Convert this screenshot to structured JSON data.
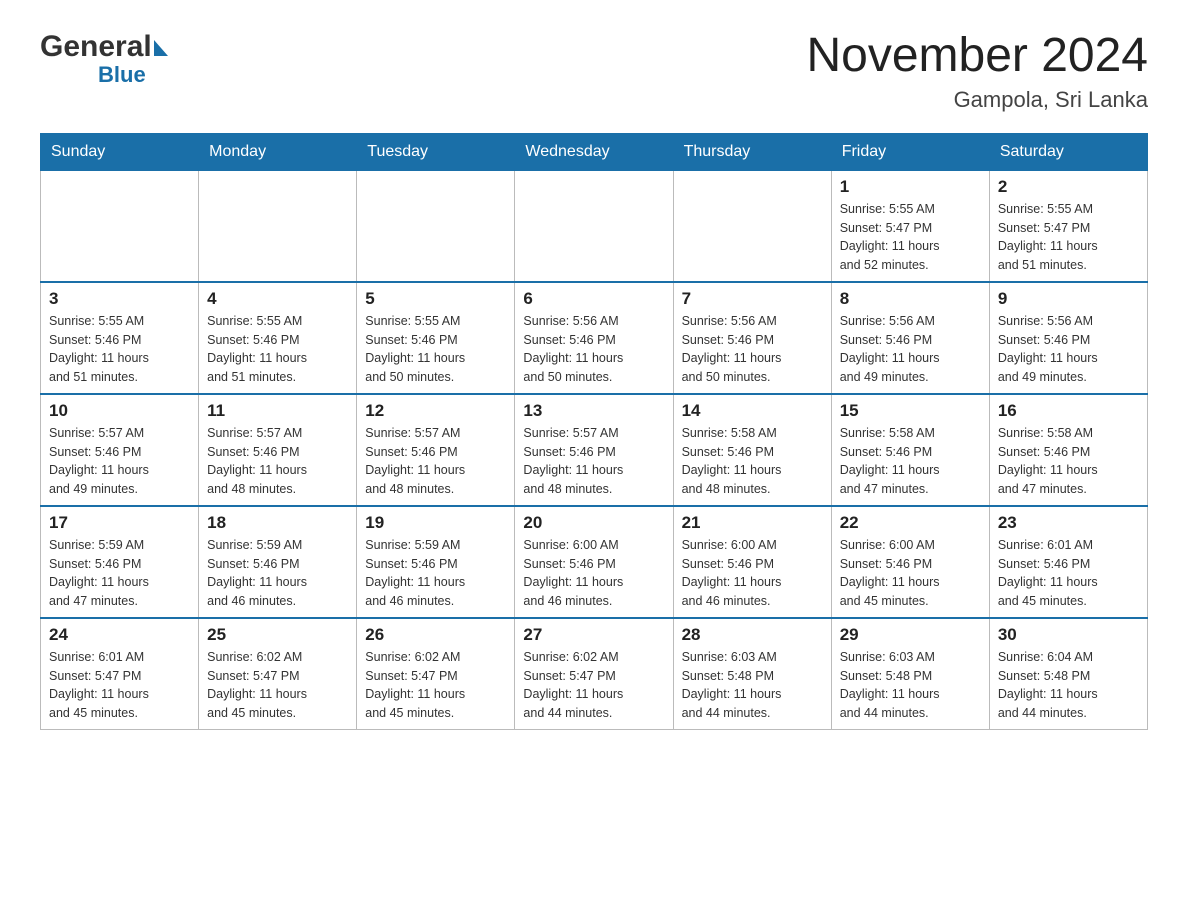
{
  "header": {
    "logo_general": "General",
    "logo_blue": "Blue",
    "month_title": "November 2024",
    "location": "Gampola, Sri Lanka"
  },
  "calendar": {
    "days_of_week": [
      "Sunday",
      "Monday",
      "Tuesday",
      "Wednesday",
      "Thursday",
      "Friday",
      "Saturday"
    ],
    "weeks": [
      [
        {
          "day": "",
          "info": ""
        },
        {
          "day": "",
          "info": ""
        },
        {
          "day": "",
          "info": ""
        },
        {
          "day": "",
          "info": ""
        },
        {
          "day": "",
          "info": ""
        },
        {
          "day": "1",
          "info": "Sunrise: 5:55 AM\nSunset: 5:47 PM\nDaylight: 11 hours\nand 52 minutes."
        },
        {
          "day": "2",
          "info": "Sunrise: 5:55 AM\nSunset: 5:47 PM\nDaylight: 11 hours\nand 51 minutes."
        }
      ],
      [
        {
          "day": "3",
          "info": "Sunrise: 5:55 AM\nSunset: 5:46 PM\nDaylight: 11 hours\nand 51 minutes."
        },
        {
          "day": "4",
          "info": "Sunrise: 5:55 AM\nSunset: 5:46 PM\nDaylight: 11 hours\nand 51 minutes."
        },
        {
          "day": "5",
          "info": "Sunrise: 5:55 AM\nSunset: 5:46 PM\nDaylight: 11 hours\nand 50 minutes."
        },
        {
          "day": "6",
          "info": "Sunrise: 5:56 AM\nSunset: 5:46 PM\nDaylight: 11 hours\nand 50 minutes."
        },
        {
          "day": "7",
          "info": "Sunrise: 5:56 AM\nSunset: 5:46 PM\nDaylight: 11 hours\nand 50 minutes."
        },
        {
          "day": "8",
          "info": "Sunrise: 5:56 AM\nSunset: 5:46 PM\nDaylight: 11 hours\nand 49 minutes."
        },
        {
          "day": "9",
          "info": "Sunrise: 5:56 AM\nSunset: 5:46 PM\nDaylight: 11 hours\nand 49 minutes."
        }
      ],
      [
        {
          "day": "10",
          "info": "Sunrise: 5:57 AM\nSunset: 5:46 PM\nDaylight: 11 hours\nand 49 minutes."
        },
        {
          "day": "11",
          "info": "Sunrise: 5:57 AM\nSunset: 5:46 PM\nDaylight: 11 hours\nand 48 minutes."
        },
        {
          "day": "12",
          "info": "Sunrise: 5:57 AM\nSunset: 5:46 PM\nDaylight: 11 hours\nand 48 minutes."
        },
        {
          "day": "13",
          "info": "Sunrise: 5:57 AM\nSunset: 5:46 PM\nDaylight: 11 hours\nand 48 minutes."
        },
        {
          "day": "14",
          "info": "Sunrise: 5:58 AM\nSunset: 5:46 PM\nDaylight: 11 hours\nand 48 minutes."
        },
        {
          "day": "15",
          "info": "Sunrise: 5:58 AM\nSunset: 5:46 PM\nDaylight: 11 hours\nand 47 minutes."
        },
        {
          "day": "16",
          "info": "Sunrise: 5:58 AM\nSunset: 5:46 PM\nDaylight: 11 hours\nand 47 minutes."
        }
      ],
      [
        {
          "day": "17",
          "info": "Sunrise: 5:59 AM\nSunset: 5:46 PM\nDaylight: 11 hours\nand 47 minutes."
        },
        {
          "day": "18",
          "info": "Sunrise: 5:59 AM\nSunset: 5:46 PM\nDaylight: 11 hours\nand 46 minutes."
        },
        {
          "day": "19",
          "info": "Sunrise: 5:59 AM\nSunset: 5:46 PM\nDaylight: 11 hours\nand 46 minutes."
        },
        {
          "day": "20",
          "info": "Sunrise: 6:00 AM\nSunset: 5:46 PM\nDaylight: 11 hours\nand 46 minutes."
        },
        {
          "day": "21",
          "info": "Sunrise: 6:00 AM\nSunset: 5:46 PM\nDaylight: 11 hours\nand 46 minutes."
        },
        {
          "day": "22",
          "info": "Sunrise: 6:00 AM\nSunset: 5:46 PM\nDaylight: 11 hours\nand 45 minutes."
        },
        {
          "day": "23",
          "info": "Sunrise: 6:01 AM\nSunset: 5:46 PM\nDaylight: 11 hours\nand 45 minutes."
        }
      ],
      [
        {
          "day": "24",
          "info": "Sunrise: 6:01 AM\nSunset: 5:47 PM\nDaylight: 11 hours\nand 45 minutes."
        },
        {
          "day": "25",
          "info": "Sunrise: 6:02 AM\nSunset: 5:47 PM\nDaylight: 11 hours\nand 45 minutes."
        },
        {
          "day": "26",
          "info": "Sunrise: 6:02 AM\nSunset: 5:47 PM\nDaylight: 11 hours\nand 45 minutes."
        },
        {
          "day": "27",
          "info": "Sunrise: 6:02 AM\nSunset: 5:47 PM\nDaylight: 11 hours\nand 44 minutes."
        },
        {
          "day": "28",
          "info": "Sunrise: 6:03 AM\nSunset: 5:48 PM\nDaylight: 11 hours\nand 44 minutes."
        },
        {
          "day": "29",
          "info": "Sunrise: 6:03 AM\nSunset: 5:48 PM\nDaylight: 11 hours\nand 44 minutes."
        },
        {
          "day": "30",
          "info": "Sunrise: 6:04 AM\nSunset: 5:48 PM\nDaylight: 11 hours\nand 44 minutes."
        }
      ]
    ]
  }
}
